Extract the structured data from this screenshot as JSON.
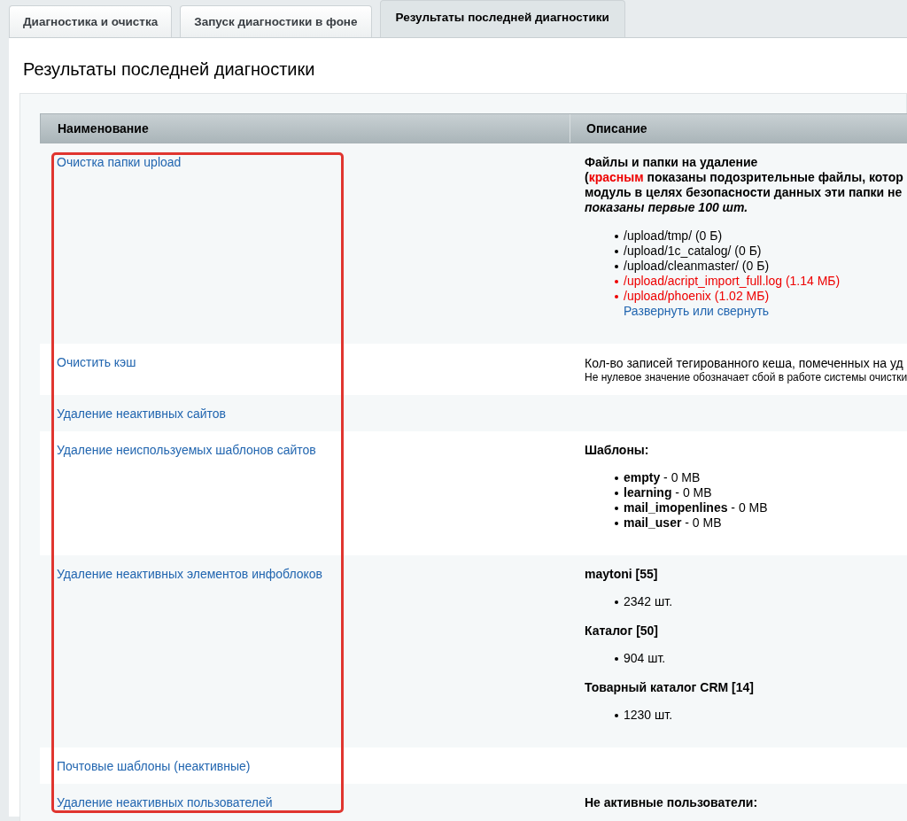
{
  "tabs": [
    {
      "label": "Диагностика и очистка",
      "selected": false
    },
    {
      "label": "Запуск диагностики в фоне",
      "selected": false
    },
    {
      "label": "Результаты последней диагностики",
      "selected": true
    }
  ],
  "page_title": "Результаты последней диагностики",
  "table": {
    "columns": [
      "Наименование",
      "Описание"
    ],
    "rows": [
      {
        "name": "Очистка папки upload",
        "description": [
          {
            "kind": "bold",
            "text": "Файлы и папки на удаление"
          },
          {
            "kind": "warning",
            "open": "(",
            "highlight": "красным",
            "text": " показаны подозрительные файлы, котор"
          },
          {
            "kind": "bold",
            "text": "модуль в целях безопасности данных эти папки не"
          },
          {
            "kind": "note",
            "text": "показаны первые 100 шт."
          },
          {
            "kind": "list",
            "items": [
              {
                "text": "/upload/tmp/ (0 Б)",
                "suspicious": false
              },
              {
                "text": "/upload/1c_catalog/ (0 Б)",
                "suspicious": false
              },
              {
                "text": "/upload/cleanmaster/ (0 Б)",
                "suspicious": false
              },
              {
                "text": "/upload/acript_import_full.log (1.14 МБ)",
                "suspicious": true
              },
              {
                "text": "/upload/phoenix (1.02 МБ)",
                "suspicious": true
              }
            ],
            "link": "Развернуть или свернуть"
          }
        ]
      },
      {
        "name": "Очистить кэш",
        "description": [
          {
            "kind": "text",
            "text": "Кол-во записей тегированного кеша, помеченных на уд"
          },
          {
            "kind": "small",
            "text": "Не нулевое значение обозначает сбой в работе системы очистки"
          }
        ]
      },
      {
        "name": "Удаление неактивных сайтов",
        "description": []
      },
      {
        "name": "Удаление неиспользуемых шаблонов сайтов",
        "description": [
          {
            "kind": "heading",
            "text": "Шаблоны:"
          },
          {
            "kind": "list",
            "items": [
              {
                "text": "**empty** - 0 MB",
                "suspicious": false
              },
              {
                "text": "**learning** - 0 MB",
                "suspicious": false
              },
              {
                "text": "**mail_imopenlines** - 0 MB",
                "suspicious": false
              },
              {
                "text": "**mail_user** - 0 MB",
                "suspicious": false
              }
            ]
          }
        ]
      },
      {
        "name": "Удаление неактивных элементов инфоблоков",
        "description": [
          {
            "kind": "heading",
            "text": "maytoni [55]"
          },
          {
            "kind": "list",
            "items": [
              {
                "text": "2342 шт.",
                "suspicious": false
              }
            ]
          },
          {
            "kind": "heading",
            "text": "Каталог [50]"
          },
          {
            "kind": "list",
            "items": [
              {
                "text": "904 шт.",
                "suspicious": false
              }
            ]
          },
          {
            "kind": "heading",
            "text": "Товарный каталог CRM [14]"
          },
          {
            "kind": "list",
            "items": [
              {
                "text": "1230 шт.",
                "suspicious": false
              }
            ]
          }
        ]
      },
      {
        "name": "Почтовые шаблоны (неактивные)",
        "description": []
      },
      {
        "name": "Удаление неактивных пользователей",
        "description": [
          {
            "kind": "heading",
            "text": "Не активные пользователи:"
          }
        ]
      }
    ]
  }
}
